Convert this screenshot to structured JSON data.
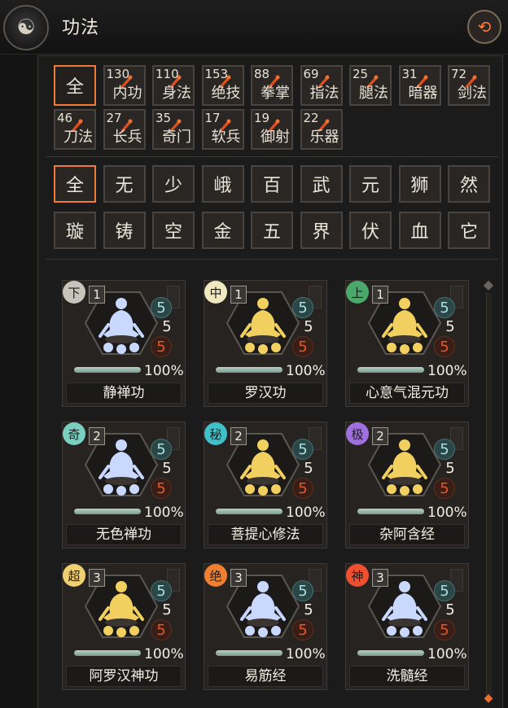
{
  "header": {
    "title": "功法",
    "back_icon": "back-arrow-icon",
    "logo_icon": "martial-artist-icon"
  },
  "categories": [
    {
      "label": "全",
      "count": null,
      "selected": true
    },
    {
      "label": "内功",
      "count": "130"
    },
    {
      "label": "身法",
      "count": "110"
    },
    {
      "label": "绝技",
      "count": "153"
    },
    {
      "label": "拳掌",
      "count": "88"
    },
    {
      "label": "指法",
      "count": "69"
    },
    {
      "label": "腿法",
      "count": "25"
    },
    {
      "label": "暗器",
      "count": "31"
    },
    {
      "label": "剑法",
      "count": "72"
    },
    {
      "label": "刀法",
      "count": "46"
    },
    {
      "label": "长兵",
      "count": "27"
    },
    {
      "label": "奇门",
      "count": "35"
    },
    {
      "label": "软兵",
      "count": "17"
    },
    {
      "label": "御射",
      "count": "19"
    },
    {
      "label": "乐器",
      "count": "22"
    }
  ],
  "sects": [
    "全",
    "无",
    "少",
    "峨",
    "百",
    "武",
    "元",
    "狮",
    "然",
    "璇",
    "铸",
    "空",
    "金",
    "五",
    "界",
    "伏",
    "血",
    "它"
  ],
  "cards": [
    {
      "name": "静禅功",
      "grade": "下",
      "grade_color": "#c8c4bc",
      "tier": "1",
      "stats": [
        "5",
        "5",
        "5"
      ],
      "percent": "100%",
      "progress": 1.0,
      "figure_color": "#c8d8ff"
    },
    {
      "name": "罗汉功",
      "grade": "中",
      "grade_color": "#f0e8c0",
      "tier": "1",
      "stats": [
        "5",
        "5",
        "5"
      ],
      "percent": "100%",
      "progress": 1.0,
      "figure_color": "#f2d060"
    },
    {
      "name": "心意气混元功",
      "grade": "上",
      "grade_color": "#4aa86a",
      "tier": "1",
      "stats": [
        "5",
        "5",
        "5"
      ],
      "percent": "100%",
      "progress": 1.0,
      "figure_color": "#f2d060"
    },
    {
      "name": "无色禅功",
      "grade": "奇",
      "grade_color": "#7ad0c0",
      "tier": "2",
      "stats": [
        "5",
        "5",
        "5"
      ],
      "percent": "100%",
      "progress": 1.0,
      "figure_color": "#c8d8ff"
    },
    {
      "name": "菩提心修法",
      "grade": "秘",
      "grade_color": "#40c0c8",
      "tier": "2",
      "stats": [
        "5",
        "5",
        "5"
      ],
      "percent": "100%",
      "progress": 1.0,
      "figure_color": "#f2d060"
    },
    {
      "name": "杂阿含经",
      "grade": "极",
      "grade_color": "#a070e0",
      "tier": "2",
      "stats": [
        "5",
        "5",
        "5"
      ],
      "percent": "100%",
      "progress": 1.0,
      "figure_color": "#f2d060"
    },
    {
      "name": "阿罗汉神功",
      "grade": "超",
      "grade_color": "#f0d070",
      "tier": "3",
      "stats": [
        "5",
        "5",
        "5"
      ],
      "percent": "100%",
      "progress": 1.0,
      "figure_color": "#f2d060"
    },
    {
      "name": "易筋经",
      "grade": "绝",
      "grade_color": "#f08030",
      "tier": "3",
      "stats": [
        "5",
        "5",
        "5"
      ],
      "percent": "100%",
      "progress": 1.0,
      "figure_color": "#c8d8ff"
    },
    {
      "name": "洗髓经",
      "grade": "神",
      "grade_color": "#f05030",
      "tier": "3",
      "stats": [
        "5",
        "5",
        "5"
      ],
      "percent": "100%",
      "progress": 1.0,
      "figure_color": "#c8d8ff"
    }
  ]
}
